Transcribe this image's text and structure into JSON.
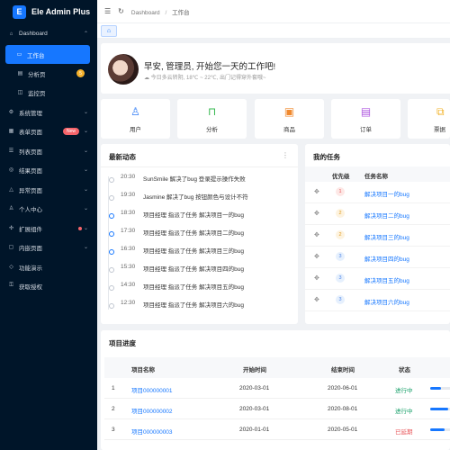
{
  "app": {
    "title": "Ele Admin Plus",
    "logo_letter": "E"
  },
  "sidebar": {
    "items": [
      {
        "label": "Dashboard",
        "icon": "home-icon"
      },
      {
        "label": "工作台",
        "icon": "desktop-icon"
      },
      {
        "label": "分析页",
        "icon": "chart-icon",
        "badge": "5"
      },
      {
        "label": "监控页",
        "icon": "monitor-icon"
      },
      {
        "label": "系统管理",
        "icon": "gear-icon"
      },
      {
        "label": "表单页面",
        "icon": "form-icon",
        "badge": "New"
      },
      {
        "label": "列表页面",
        "icon": "list-icon"
      },
      {
        "label": "结果页面",
        "icon": "check-circle-icon"
      },
      {
        "label": "异常页面",
        "icon": "warning-icon"
      },
      {
        "label": "个人中心",
        "icon": "user-icon"
      },
      {
        "label": "扩展组件",
        "icon": "puzzle-icon"
      },
      {
        "label": "内嵌页面",
        "icon": "window-icon"
      },
      {
        "label": "功能演示",
        "icon": "demo-icon"
      },
      {
        "label": "获取授权",
        "icon": "key-icon"
      }
    ]
  },
  "header": {
    "breadcrumb_root": "Dashboard",
    "breadcrumb_sep": "/",
    "breadcrumb_current": "工作台"
  },
  "welcome": {
    "greeting": "早安, 管理员, 开始您一天的工作吧!",
    "weather": "今日多云转阴, 18℃ ~ 22℃, 出门记得穿外套哦~"
  },
  "quick_links": [
    {
      "label": "用户",
      "icon": "user-icon",
      "color": "#2f7bf5"
    },
    {
      "label": "分析",
      "icon": "easel-icon",
      "color": "#35b94f"
    },
    {
      "label": "商品",
      "icon": "bag-icon",
      "color": "#f0892e"
    },
    {
      "label": "订单",
      "icon": "document-icon",
      "color": "#b05be0"
    },
    {
      "label": "票据",
      "icon": "ticket-icon",
      "color": "#f2b32b"
    }
  ],
  "activity": {
    "title": "最新动态",
    "items": [
      {
        "time": "20:30",
        "text": "SunSmile 解决了bug 登录提示操作失败"
      },
      {
        "time": "19:30",
        "text": "Jasmine 解决了bug 按钮颜色与设计不符"
      },
      {
        "time": "18:30",
        "text": "项目经理 指派了任务 解决项目一的bug"
      },
      {
        "time": "17:30",
        "text": "项目经理 指派了任务 解决项目二的bug"
      },
      {
        "time": "16:30",
        "text": "项目经理 指派了任务 解决项目三的bug"
      },
      {
        "time": "15:30",
        "text": "项目经理 指派了任务 解决项目四的bug"
      },
      {
        "time": "14:30",
        "text": "项目经理 指派了任务 解决项目五的bug"
      },
      {
        "time": "12:30",
        "text": "项目经理 指派了任务 解决项目六的bug"
      }
    ]
  },
  "tasks": {
    "title": "我的任务",
    "col_priority": "优先级",
    "col_name": "任务名称",
    "items": [
      {
        "priority": "1",
        "name": "解决项目一的bug"
      },
      {
        "priority": "2",
        "name": "解决项目二的bug"
      },
      {
        "priority": "2",
        "name": "解决项目三的bug"
      },
      {
        "priority": "3",
        "name": "解决项目四的bug"
      },
      {
        "priority": "3",
        "name": "解决项目五的bug"
      },
      {
        "priority": "3",
        "name": "解决项目六的bug"
      }
    ]
  },
  "projects": {
    "title": "项目进度",
    "col_name": "项目名称",
    "col_start": "开始时间",
    "col_end": "结束时间",
    "col_status": "状态",
    "rows": [
      {
        "index": "1",
        "name": "项目000000001",
        "start": "2020-03-01",
        "end": "2020-06-01",
        "status": "进行中",
        "status_color": "#19a06a",
        "progress": 0.3
      },
      {
        "index": "2",
        "name": "项目000000002",
        "start": "2020-03-01",
        "end": "2020-08-01",
        "status": "进行中",
        "status_color": "#19a06a",
        "progress": 0.5
      },
      {
        "index": "3",
        "name": "项目000000003",
        "start": "2020-01-01",
        "end": "2020-05-01",
        "status": "已延期",
        "status_color": "#e8565a",
        "progress": 0.4
      }
    ]
  },
  "colors": {
    "accent": "#1677ff",
    "sidebar_bg": "#001529"
  }
}
